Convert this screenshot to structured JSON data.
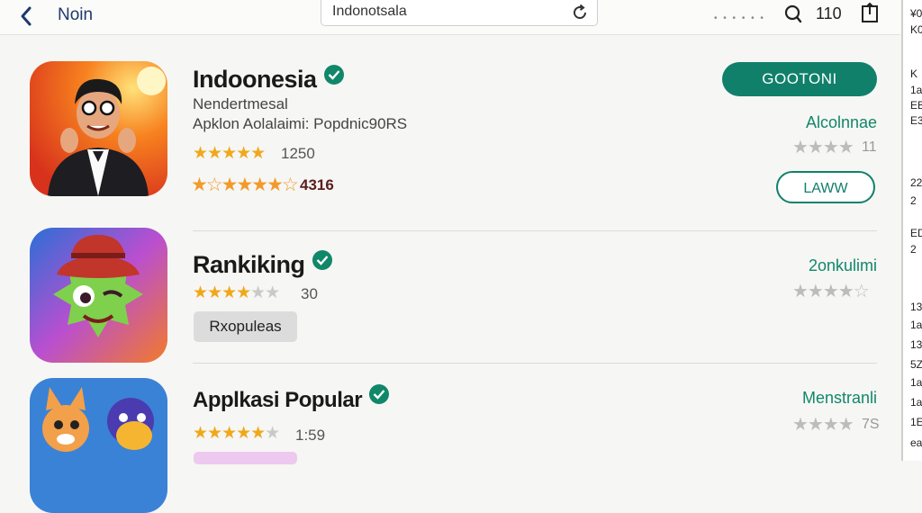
{
  "topbar": {
    "title": "Noin",
    "search_value": "Indonotsala",
    "count": "110",
    "dots": "• • • • • •"
  },
  "apps": [
    {
      "name": "Indoonesia",
      "subtitle1": "Nendertmesal",
      "subtitle2": "Apklon Aolalaimi: Popdnic90RS",
      "rating_count": "1250",
      "rating2_count": "4316",
      "primary_button": "GOOTONI",
      "green_label": "Alcolnnae",
      "gray_num": "11",
      "outline_button": "LAWW"
    },
    {
      "name": "Rankiking",
      "rating_count": "30",
      "tag": "Rxopuleas",
      "green_label": "2onkulimi"
    },
    {
      "name": "Applkasi Popular",
      "rating_count": "1:59",
      "green_label": "Menstranli",
      "gray_num": "7S"
    }
  ],
  "right_panel": [
    "¥0",
    "K0",
    "K",
    "1a",
    "EB",
    "E3",
    "22",
    "2",
    "ED",
    "2",
    "13",
    "1a",
    "13",
    "5Z",
    "1a",
    "1a",
    "1E",
    "ea"
  ],
  "colors": {
    "accent": "#10806a",
    "star": "#f0a81b",
    "star_off": "#c9c9c9"
  },
  "icons": {
    "back": "chevron-left-icon",
    "refresh": "refresh-icon",
    "search": "search-icon",
    "share": "share-icon",
    "verified": "verified-check-icon"
  }
}
